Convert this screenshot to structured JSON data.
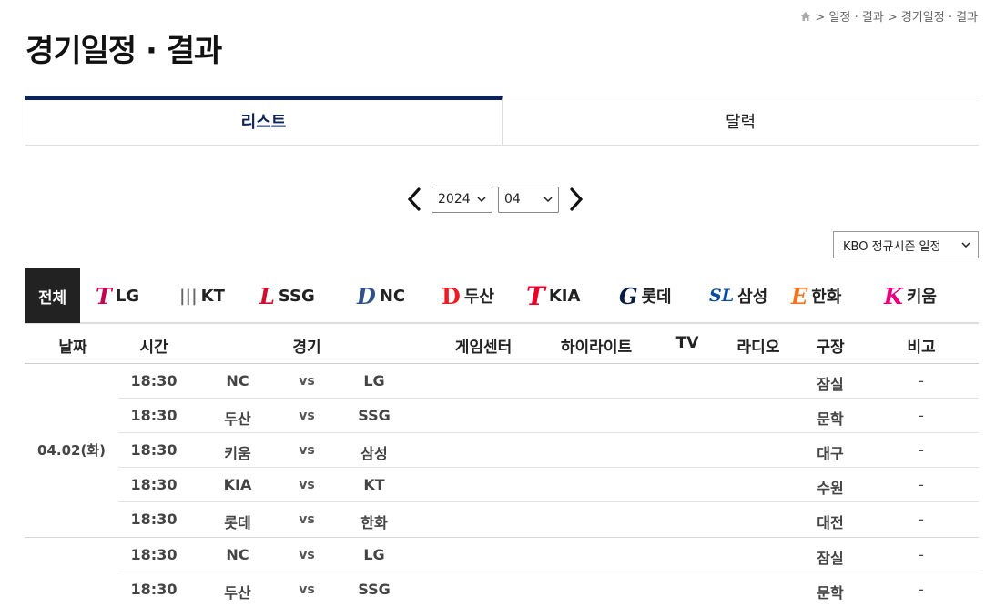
{
  "breadcrumb": {
    "path": "> 일정 · 결과 > 경기일정 · 결과"
  },
  "page_title": "경기일정 · 결과",
  "tabs": [
    {
      "label": "리스트"
    },
    {
      "label": "달력"
    }
  ],
  "date_nav": {
    "year": "2024",
    "month": "04"
  },
  "season_select": {
    "value": "KBO 정규시즌 일정"
  },
  "team_filter": {
    "all_label": "전체",
    "teams": [
      {
        "name": "LG",
        "logo": "T",
        "color": "#c30452"
      },
      {
        "name": "KT",
        "logo": "|||",
        "color": "#666666"
      },
      {
        "name": "SSG",
        "logo": "L",
        "color": "#ce0e2d"
      },
      {
        "name": "NC",
        "logo": "D",
        "color": "#315288"
      },
      {
        "name": "두산",
        "logo": "D",
        "color": "#ed1c24"
      },
      {
        "name": "KIA",
        "logo": "T",
        "color": "#ea0029"
      },
      {
        "name": "롯데",
        "logo": "G",
        "color": "#041e42"
      },
      {
        "name": "삼성",
        "logo": "SL",
        "color": "#074ca1"
      },
      {
        "name": "한화",
        "logo": "E",
        "color": "#f37321"
      },
      {
        "name": "키움",
        "logo": "K",
        "color": "#e6007e"
      }
    ]
  },
  "table": {
    "headers": [
      "날짜",
      "시간",
      "경기",
      "게임센터",
      "하이라이트",
      "TV",
      "라디오",
      "구장",
      "비고"
    ],
    "vs_label": "vs",
    "groups": [
      {
        "date": "04.02(화)",
        "games": [
          {
            "time": "18:30",
            "away": "NC",
            "home": "LG",
            "stadium": "잠실",
            "note": "-"
          },
          {
            "time": "18:30",
            "away": "두산",
            "home": "SSG",
            "stadium": "문학",
            "note": "-"
          },
          {
            "time": "18:30",
            "away": "키움",
            "home": "삼성",
            "stadium": "대구",
            "note": "-"
          },
          {
            "time": "18:30",
            "away": "KIA",
            "home": "KT",
            "stadium": "수원",
            "note": "-"
          },
          {
            "time": "18:30",
            "away": "롯데",
            "home": "한화",
            "stadium": "대전",
            "note": "-"
          }
        ]
      },
      {
        "date": "",
        "games": [
          {
            "time": "18:30",
            "away": "NC",
            "home": "LG",
            "stadium": "잠실",
            "note": "-"
          },
          {
            "time": "18:30",
            "away": "두산",
            "home": "SSG",
            "stadium": "문학",
            "note": "-"
          }
        ]
      }
    ]
  },
  "colors": {
    "accent": "#0c2358",
    "all_bg": "#222222"
  }
}
